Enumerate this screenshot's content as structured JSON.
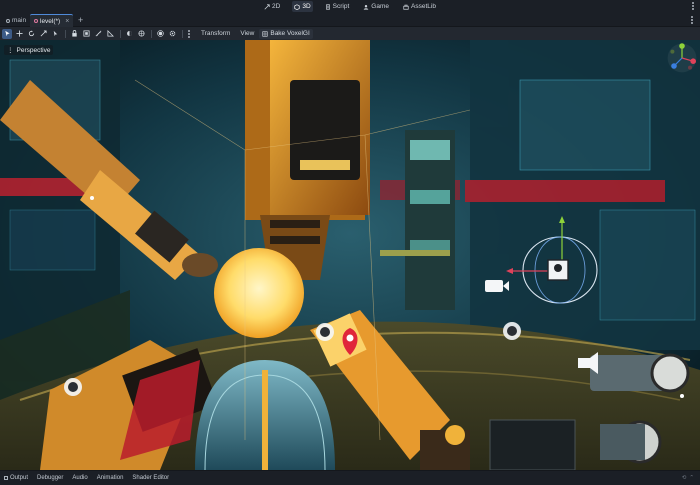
{
  "workspaces": [
    {
      "label": "2D",
      "icon": "2d-icon",
      "active": false
    },
    {
      "label": "3D",
      "icon": "3d-icon",
      "active": true
    },
    {
      "label": "Script",
      "icon": "script-icon",
      "active": false
    },
    {
      "label": "Game",
      "icon": "game-icon",
      "active": false
    },
    {
      "label": "AssetLib",
      "icon": "assetlib-icon",
      "active": false
    }
  ],
  "tabs": [
    {
      "label": "main",
      "active": false
    },
    {
      "label": "level(*)",
      "active": true
    }
  ],
  "toolbar": {
    "transform_menu": "Transform",
    "view_menu": "View",
    "bake_button": "Bake VoxelGI"
  },
  "viewport": {
    "perspective_label": "Perspective"
  },
  "bottom_panels": [
    {
      "label": "Output",
      "icon": "output-icon"
    },
    {
      "label": "Debugger",
      "icon": ""
    },
    {
      "label": "Audio",
      "icon": ""
    },
    {
      "label": "Animation",
      "icon": ""
    },
    {
      "label": "Shader Editor",
      "icon": ""
    }
  ],
  "colors": {
    "accent": "#4f8ad9",
    "active_tool": "#3d5b87",
    "axis_x": "#e0425a",
    "axis_y": "#8ed33a",
    "axis_z": "#3a7fe0",
    "selection_marker": "#e0263a"
  }
}
